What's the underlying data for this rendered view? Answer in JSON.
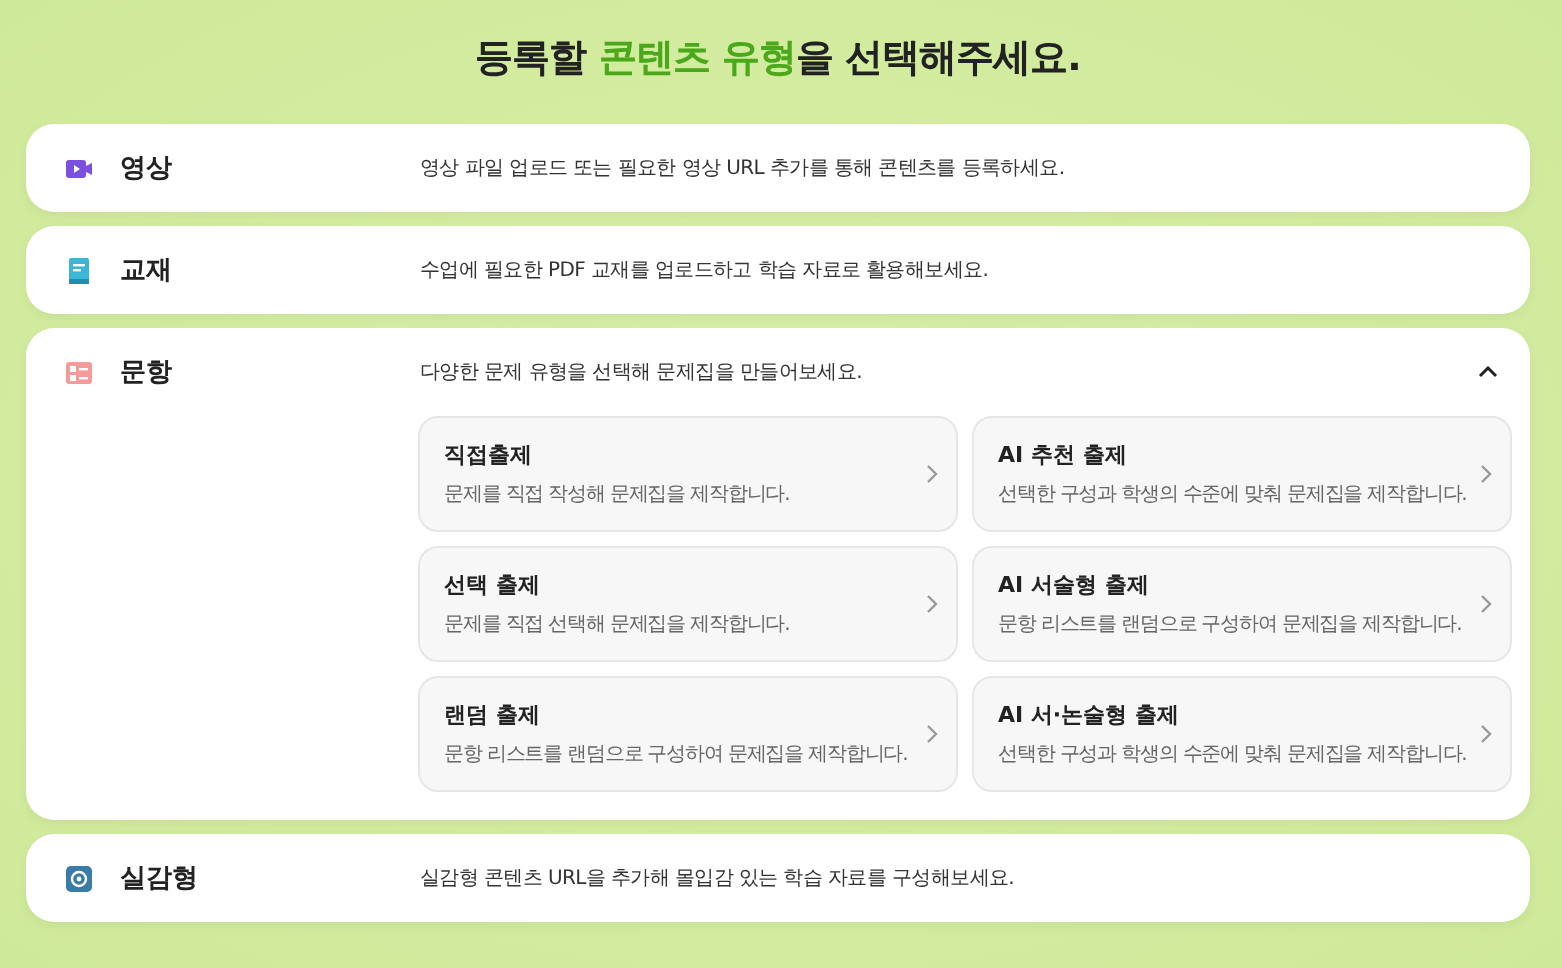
{
  "heading": {
    "before": "등록할 ",
    "highlight": "콘텐츠 유형",
    "after": "을 선택해주세요."
  },
  "content_types": [
    {
      "kind": "video",
      "label": "영상",
      "description": "영상 파일 업로드 또는 필요한 영상 URL 추가를 통해 콘텐츠를 등록하세요.",
      "expanded": false
    },
    {
      "kind": "book",
      "label": "교재",
      "description": "수업에 필요한 PDF 교재를 업로드하고 학습 자료로 활용해보세요.",
      "expanded": false
    },
    {
      "kind": "quiz",
      "label": "문항",
      "description": "다양한 문제 유형을 선택해 문제집을 만들어보세요.",
      "expanded": true,
      "options": [
        {
          "title": "직접출제",
          "description": "문제를 직접 작성해 문제집을 제작합니다."
        },
        {
          "title": "AI 추천 출제",
          "description": "선택한 구성과 학생의 수준에 맞춰 문제집을 제작합니다."
        },
        {
          "title": "선택 출제",
          "description": "문제를 직접 선택해 문제집을 제작합니다."
        },
        {
          "title": "AI 서술형 출제",
          "description": "문항 리스트를 랜덤으로 구성하여 문제집을 제작합니다."
        },
        {
          "title": "랜덤 출제",
          "description": "문항 리스트를 랜덤으로 구성하여 문제집을 제작합니다."
        },
        {
          "title": "AI 서·논술형 출제",
          "description": "선택한 구성과 학생의 수준에 맞춰 문제집을 제작합니다."
        }
      ]
    },
    {
      "kind": "vr",
      "label": "실감형",
      "description": "실감형 콘텐츠 URL을 추가해 몰입감 있는 학습 자료를 구성해보세요.",
      "expanded": false
    }
  ]
}
